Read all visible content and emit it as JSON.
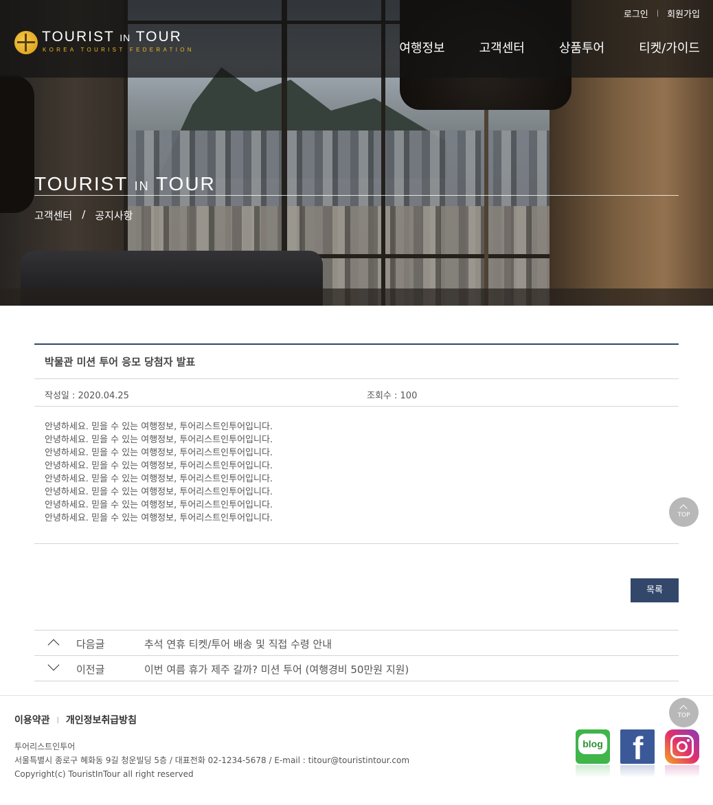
{
  "brand": {
    "name_main": "TOURIST",
    "name_small": "IN",
    "name_end": "TOUR",
    "tagline": "KOREA TOURIST FEDERATION"
  },
  "toplinks": {
    "login": "로그인",
    "signup": "회원가입"
  },
  "gnb": [
    "여행정보",
    "고객센터",
    "상품투어",
    "티켓/가이드"
  ],
  "hero": {
    "title_main": "TOURIST",
    "title_small": "IN",
    "title_end": "TOUR",
    "breadcrumb": [
      "고객센터",
      "공지사항"
    ]
  },
  "post": {
    "title": "박물관 미션 투어 응모 당첨자 발표",
    "date_label": "작성일 : 2020.04.25",
    "views_label": "조회수 : 100",
    "lines": [
      "안녕하세요. 믿을 수 있는 여행정보, 투어리스트인투어입니다.",
      "안녕하세요. 믿을 수 있는 여행정보, 투어리스트인투어입니다.",
      "안녕하세요. 믿을 수 있는 여행정보, 투어리스트인투어입니다.",
      "안녕하세요. 믿을 수 있는 여행정보, 투어리스트인투어입니다.",
      "안녕하세요. 믿을 수 있는 여행정보, 투어리스트인투어입니다.",
      "안녕하세요. 믿을 수 있는 여행정보, 투어리스트인투어입니다.",
      "안녕하세요. 믿을 수 있는 여행정보, 투어리스트인투어입니다.",
      "안녕하세요. 믿을 수 있는 여행정보, 투어리스트인투어입니다."
    ]
  },
  "list_button": "목록",
  "adjacent": {
    "next": {
      "label": "다음글",
      "title": "추석 연휴 티켓/투어 배송 및 직접 수령 안내"
    },
    "prev": {
      "label": "이전글",
      "title": "이번 여름 휴가 제주 갈까? 미션 투어 (여행경비 50만원 지원)"
    }
  },
  "top_button": "TOP",
  "footer": {
    "terms": "이용약관",
    "privacy": "개인정보취급방침",
    "company": "투어리스트인투어",
    "address": "서울특별시 종로구 혜화동 9길 청운빌딩 5층 / 대표전화 02-1234-5678 / E-mail : titour@touristintour.com",
    "copyright": "Copyright(c) TouristInTour all right reserved"
  },
  "sns": {
    "blog_text": "blog",
    "facebook_text": "f"
  },
  "icons": {
    "top": "chevron-up-icon",
    "next": "chevron-up-icon",
    "prev": "chevron-down-icon",
    "logo": "compass-icon"
  },
  "colors": {
    "accent": "#33476b",
    "brand_gold": "#f2b823",
    "top_button": "#b8b8b8"
  }
}
